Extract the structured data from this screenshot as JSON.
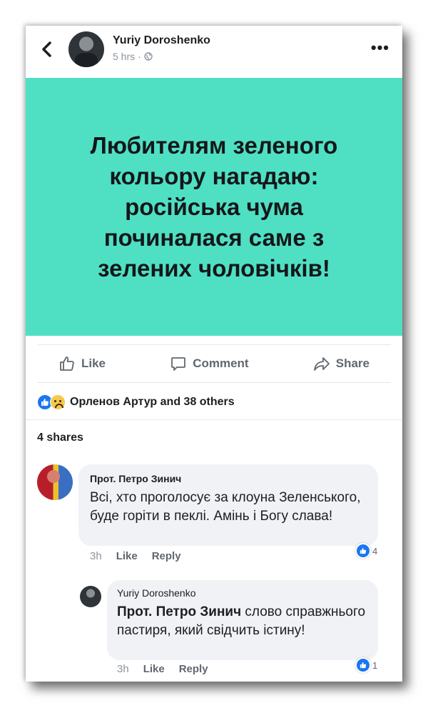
{
  "header": {
    "author": "Yuriy Doroshenko",
    "time": "5 hrs",
    "time_separator": "·",
    "more_label": "•••"
  },
  "post": {
    "text_lines": [
      "Любителям зеленого",
      "кольору нагадаю:",
      "російська чума",
      "починалася саме з",
      "зелених чоловічків!"
    ],
    "background_color": "#4fe0c4"
  },
  "actions": {
    "like": "Like",
    "comment": "Comment",
    "share": "Share"
  },
  "reactions": {
    "text": "Орленов Артур and 38 others",
    "icons": [
      "like-icon",
      "sad-icon"
    ]
  },
  "shares": {
    "text": "4 shares"
  },
  "comments": [
    {
      "author": "Прот. Петро Зинич",
      "text": "Всі, хто проголосує за клоуна Зеленського, буде горіти в пеклі. Амінь і Богу слава!",
      "time": "3h",
      "like_label": "Like",
      "reply_label": "Reply",
      "like_count": "4"
    },
    {
      "author": "Yuriy Doroshenko",
      "mention": "Прот. Петро Зинич",
      "text": " слово справжнього пастиря, який свідчить істину!",
      "time": "3h",
      "like_label": "Like",
      "reply_label": "Reply",
      "like_count": "1"
    }
  ]
}
